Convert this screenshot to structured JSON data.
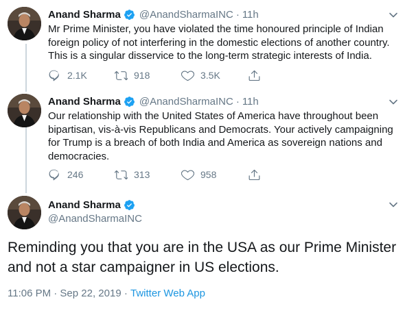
{
  "colors": {
    "verified": "#1da1f2",
    "secondary_text": "#657786",
    "link": "#1b95e0",
    "thread_line": "#ccd6dd"
  },
  "tweets": [
    {
      "name": "Anand Sharma",
      "handle": "@AnandSharmaINC",
      "separator": "·",
      "time": "11h",
      "text": "Mr Prime Minister, you have violated the time honoured principle of Indian foreign policy of not interfering in the domestic elections of another country. This is a singular disservice to the long-term strategic interests of India.",
      "replies": "2.1K",
      "retweets": "918",
      "likes": "3.5K"
    },
    {
      "name": "Anand Sharma",
      "handle": "@AnandSharmaINC",
      "separator": "·",
      "time": "11h",
      "text": "Our relationship with the United States of America have throughout been bipartisan, vis-à-vis Republicans and Democrats. Your actively campaigning for Trump is a breach of both India and America as sovereign nations and democracies.",
      "replies": "246",
      "retweets": "313",
      "likes": "958"
    }
  ],
  "main_tweet": {
    "name": "Anand Sharma",
    "handle": "@AnandSharmaINC",
    "text": "Reminding you that you are in the USA as our Prime Minister and not a star campaigner in US elections.",
    "timestamp": "11:06 PM · Sep 22, 2019",
    "meta_separator": " · ",
    "source": "Twitter Web App"
  },
  "icons": {
    "verified": "verified-badge-icon",
    "caret": "chevron-down-icon",
    "reply": "reply-icon",
    "retweet": "retweet-icon",
    "like": "heart-icon",
    "share": "share-icon"
  }
}
